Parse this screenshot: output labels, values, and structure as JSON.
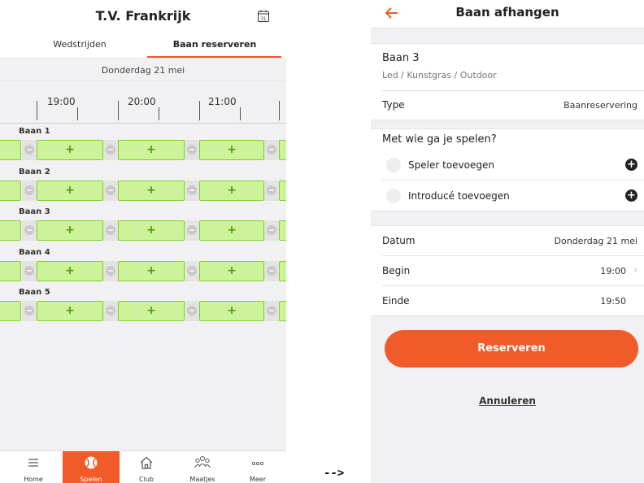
{
  "left": {
    "title": "T.V. Frankrijk",
    "tabs": [
      {
        "label": "Wedstrijden",
        "active": false
      },
      {
        "label": "Baan reserveren",
        "active": true
      }
    ],
    "date": "Donderdag 21 mei",
    "times": [
      "19:00",
      "20:00",
      "21:00"
    ],
    "courts": [
      {
        "label": "Baan 1"
      },
      {
        "label": "Baan 2"
      },
      {
        "label": "Baan 3"
      },
      {
        "label": "Baan 4"
      },
      {
        "label": "Baan 5"
      }
    ],
    "slot_symbol": "+",
    "nav": [
      {
        "label": "Home",
        "icon": "menu-icon",
        "active": false
      },
      {
        "label": "Spelen",
        "icon": "tennis-ball-icon",
        "active": true
      },
      {
        "label": "Club",
        "icon": "home-icon",
        "active": false
      },
      {
        "label": "Maatjes",
        "icon": "people-icon",
        "active": false
      },
      {
        "label": "Meer",
        "icon": "more-icon",
        "active": false
      }
    ]
  },
  "arrow": "-->",
  "right": {
    "title": "Baan afhangen",
    "court": {
      "name": "Baan 3",
      "details": "Led / Kunstgras / Outdoor"
    },
    "type": {
      "label": "Type",
      "value": "Baanreservering"
    },
    "players_title": "Met wie ga je spelen?",
    "add_player": "Speler toevoegen",
    "add_intro": "Introducé toevoegen",
    "datum": {
      "label": "Datum",
      "value": "Donderdag 21 mei"
    },
    "begin": {
      "label": "Begin",
      "value": "19:00"
    },
    "einde": {
      "label": "Einde",
      "value": "19:50"
    },
    "reserve_button": "Reserveren",
    "cancel_link": "Annuleren"
  },
  "colors": {
    "accent": "#f15a29",
    "slot_fill": "#cdf39a",
    "slot_border": "#7ed321"
  }
}
